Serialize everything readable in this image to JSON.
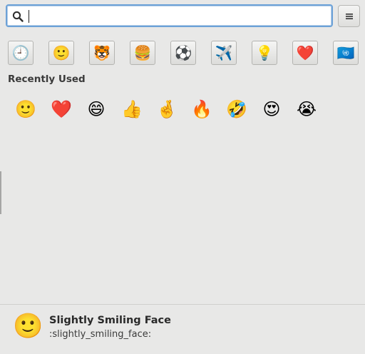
{
  "search": {
    "value": "",
    "placeholder": ""
  },
  "menu": {
    "icon": "hamburger-menu-icon"
  },
  "categories": [
    {
      "name": "recent",
      "glyph": "🕘"
    },
    {
      "name": "smileys",
      "glyph": "🙂"
    },
    {
      "name": "animals",
      "glyph": "🐯"
    },
    {
      "name": "food",
      "glyph": "🍔"
    },
    {
      "name": "activities",
      "glyph": "⚽"
    },
    {
      "name": "travel",
      "glyph": "✈️"
    },
    {
      "name": "objects",
      "glyph": "💡"
    },
    {
      "name": "symbols",
      "glyph": "❤️"
    },
    {
      "name": "flags",
      "glyph": "🇺🇳"
    }
  ],
  "section_title": "Recently Used",
  "recent": [
    "🙂",
    "❤️",
    "😄",
    "👍",
    "🤞",
    "🔥",
    "🤣",
    "😍",
    "😭"
  ],
  "footer": {
    "emoji": "🙂",
    "name": "Slightly Smiling Face",
    "code": ":slightly_smiling_face:"
  },
  "colors": {
    "focus_border": "#6ca1d7",
    "background": "#e8e8e7"
  }
}
